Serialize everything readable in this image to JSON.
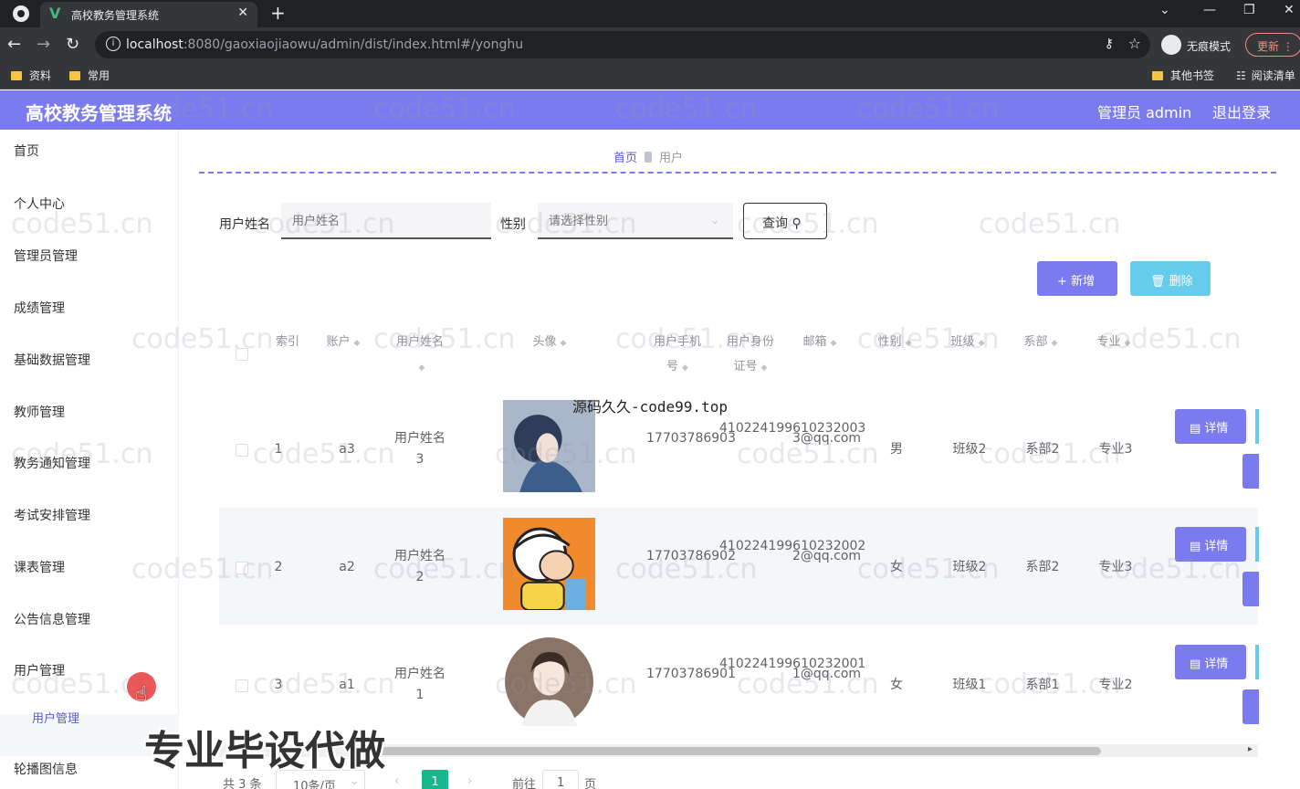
{
  "browser": {
    "tab_title": "高校教务管理系统",
    "url_host": "localhost",
    "url_rest": ":8080/gaoxiaojiaowu/admin/dist/index.html#/yonghu",
    "incognito_label": "无痕模式",
    "update_label": "更新",
    "bookmarks": [
      "资料",
      "常用"
    ],
    "bookmarks_right": [
      "其他书签",
      "阅读清单"
    ]
  },
  "header": {
    "title": "高校教务管理系统",
    "user": "管理员 admin",
    "logout": "退出登录"
  },
  "sidebar": {
    "items": [
      "首页",
      "个人中心",
      "管理员管理",
      "成绩管理",
      "基础数据管理",
      "教师管理",
      "教务通知管理",
      "考试安排管理",
      "课表管理",
      "公告信息管理",
      "用户管理",
      "轮播图信息"
    ],
    "submenu_active": "用户管理"
  },
  "breadcrumb": {
    "home": "首页",
    "current": "用户"
  },
  "search": {
    "name_label": "用户姓名",
    "name_placeholder": "用户姓名",
    "gender_label": "性别",
    "gender_placeholder": "请选择性别",
    "query_label": "查询"
  },
  "actions": {
    "add": "新增",
    "delete": "删除"
  },
  "table": {
    "headers": [
      "索引",
      "账户",
      "用户姓名",
      "头像",
      "用户手机号",
      "用户身份证号",
      "邮箱",
      "性别",
      "班级",
      "系部",
      "专业"
    ],
    "detail_label": "详情",
    "rows": [
      {
        "index": "1",
        "account": "a3",
        "name": "用户姓名3",
        "phone": "17703786903",
        "idcard": "410224199610232003",
        "email": "3@qq.com",
        "gender": "男",
        "class": "班级2",
        "dept": "系部2",
        "major": "专业3"
      },
      {
        "index": "2",
        "account": "a2",
        "name": "用户姓名2",
        "phone": "17703786902",
        "idcard": "410224199610232002",
        "email": "2@qq.com",
        "gender": "女",
        "class": "班级2",
        "dept": "系部2",
        "major": "专业3"
      },
      {
        "index": "3",
        "account": "a1",
        "name": "用户姓名1",
        "phone": "17703786901",
        "idcard": "410224199610232001",
        "email": "1@qq.com",
        "gender": "女",
        "class": "班级1",
        "dept": "系部1",
        "major": "专业2"
      }
    ]
  },
  "pagination": {
    "total": "共 3 条",
    "page_size": "10条/页",
    "current_page": "1",
    "goto_prefix": "前往",
    "goto_value": "1",
    "goto_suffix": "页"
  },
  "overlay": {
    "watermark": "code51.cn",
    "source_text": "源码久久-code99.top",
    "caption": "专业毕设代做"
  }
}
